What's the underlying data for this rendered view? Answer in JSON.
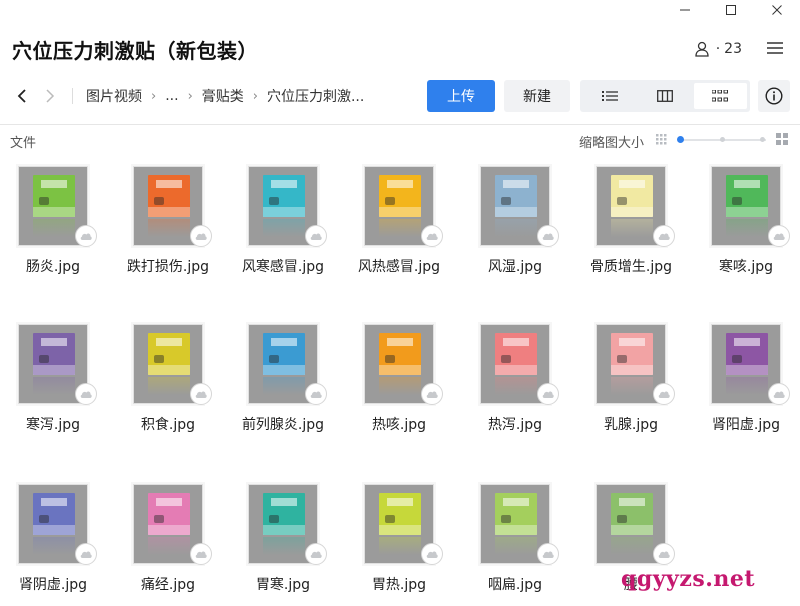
{
  "window": {
    "minimize_icon": "minimize-icon",
    "maximize_icon": "maximize-icon",
    "close_icon": "close-icon"
  },
  "header": {
    "title": "穴位压力刺激贴（新包装）",
    "members_count": "23",
    "members_sep": "·"
  },
  "toolbar": {
    "breadcrumb": [
      "图片视频",
      "...",
      "膏贴类",
      "穴位压力刺激..."
    ],
    "upload_label": "上传",
    "new_label": "新建",
    "views": [
      "list-view-icon",
      "column-view-icon",
      "grid-view-icon"
    ],
    "active_view": 2
  },
  "list_header": {
    "column_label": "文件",
    "thumb_size_label": "缩略图大小",
    "thumb_size_level": 0
  },
  "files": [
    {
      "name": "肠炎.jpg",
      "color": "#7cc243"
    },
    {
      "name": "跌打损伤.jpg",
      "color": "#ec6a2c"
    },
    {
      "name": "风寒感冒.jpg",
      "color": "#35b7c8"
    },
    {
      "name": "风热感冒.jpg",
      "color": "#f3b51c"
    },
    {
      "name": "风湿.jpg",
      "color": "#8db2cf"
    },
    {
      "name": "骨质增生.jpg",
      "color": "#f1e9a2"
    },
    {
      "name": "寒咳.jpg",
      "color": "#50b85a"
    },
    {
      "name": "寒泻.jpg",
      "color": "#7d63a8"
    },
    {
      "name": "积食.jpg",
      "color": "#d8c92a"
    },
    {
      "name": "前列腺炎.jpg",
      "color": "#3b9bd2"
    },
    {
      "name": "热咳.jpg",
      "color": "#f29b1c"
    },
    {
      "name": "热泻.jpg",
      "color": "#ef7f80"
    },
    {
      "name": "乳腺.jpg",
      "color": "#f2a3a4"
    },
    {
      "name": "肾阳虚.jpg",
      "color": "#8d56a4"
    },
    {
      "name": "肾阴虚.jpg",
      "color": "#6a74c0"
    },
    {
      "name": "痛经.jpg",
      "color": "#e47cb4"
    },
    {
      "name": "胃寒.jpg",
      "color": "#2fb3a0"
    },
    {
      "name": "胃热.jpg",
      "color": "#c6d83a"
    },
    {
      "name": "咽扁.jpg",
      "color": "#a4cf5d"
    },
    {
      "name": "腰",
      "color": "#8cc06a"
    }
  ],
  "watermark": "qgyyzs.net"
}
